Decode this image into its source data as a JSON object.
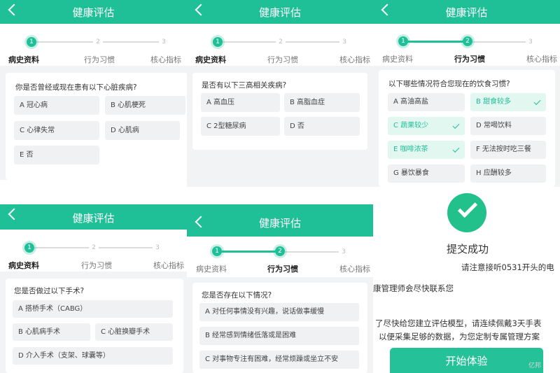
{
  "common": {
    "title": "健康评估",
    "steps": [
      {
        "num": "1",
        "label": "病史资料"
      },
      {
        "num": "2",
        "label": "行为习惯"
      },
      {
        "num": "3",
        "label": "核心指标"
      }
    ]
  },
  "screen1": {
    "question": "你是否曾经或现在患有以下心脏疾病?",
    "options": [
      "A 冠心病",
      "B 心肌梗死",
      "C 心律失常",
      "D 心肌病",
      "E 否"
    ]
  },
  "screen2": {
    "question": "是否有以下三高相关疾病?",
    "options": [
      "A 高血压",
      "B 高脂血症",
      "C 2型糖尿病",
      "D 否"
    ]
  },
  "screen3": {
    "question": "以下哪些情况符合您现在的饮食习惯?",
    "options": [
      "A 高油高盐",
      "B 甜食较多",
      "C 蔬果较少",
      "D 常喝饮料",
      "E 咖啡浓茶",
      "F 无法按时吃三餐",
      "G 暴饮暴食",
      "H 应酬较多"
    ],
    "selected": [
      1,
      2,
      4
    ]
  },
  "screen4": {
    "question": "您是否做过以下手术?",
    "options": [
      "A 搭桥手术（CABG）",
      "B 心肌病手术",
      "C 心脏换瓣手术",
      "D 介入手术（支架、球囊等）"
    ]
  },
  "screen5": {
    "question": "您是否存在以下情况?",
    "options": [
      "A 对任何事情没有兴趣，说话做事缓慢",
      "B 经常感到情绪低落或是困难",
      "C 对事物专注有困难，经常烦躁或坐立不安"
    ]
  },
  "screen6": {
    "title": "提交成功",
    "line1": "请注意接听0531开头的电",
    "line2": "康管理师会尽快联系您",
    "line3": "了尽快给您建立评估模型，请连续佩戴3天手表",
    "line4": "以便采集足够的数据，为您定制专属管理方案",
    "button": "开始体验",
    "watermark": "亿邦"
  }
}
